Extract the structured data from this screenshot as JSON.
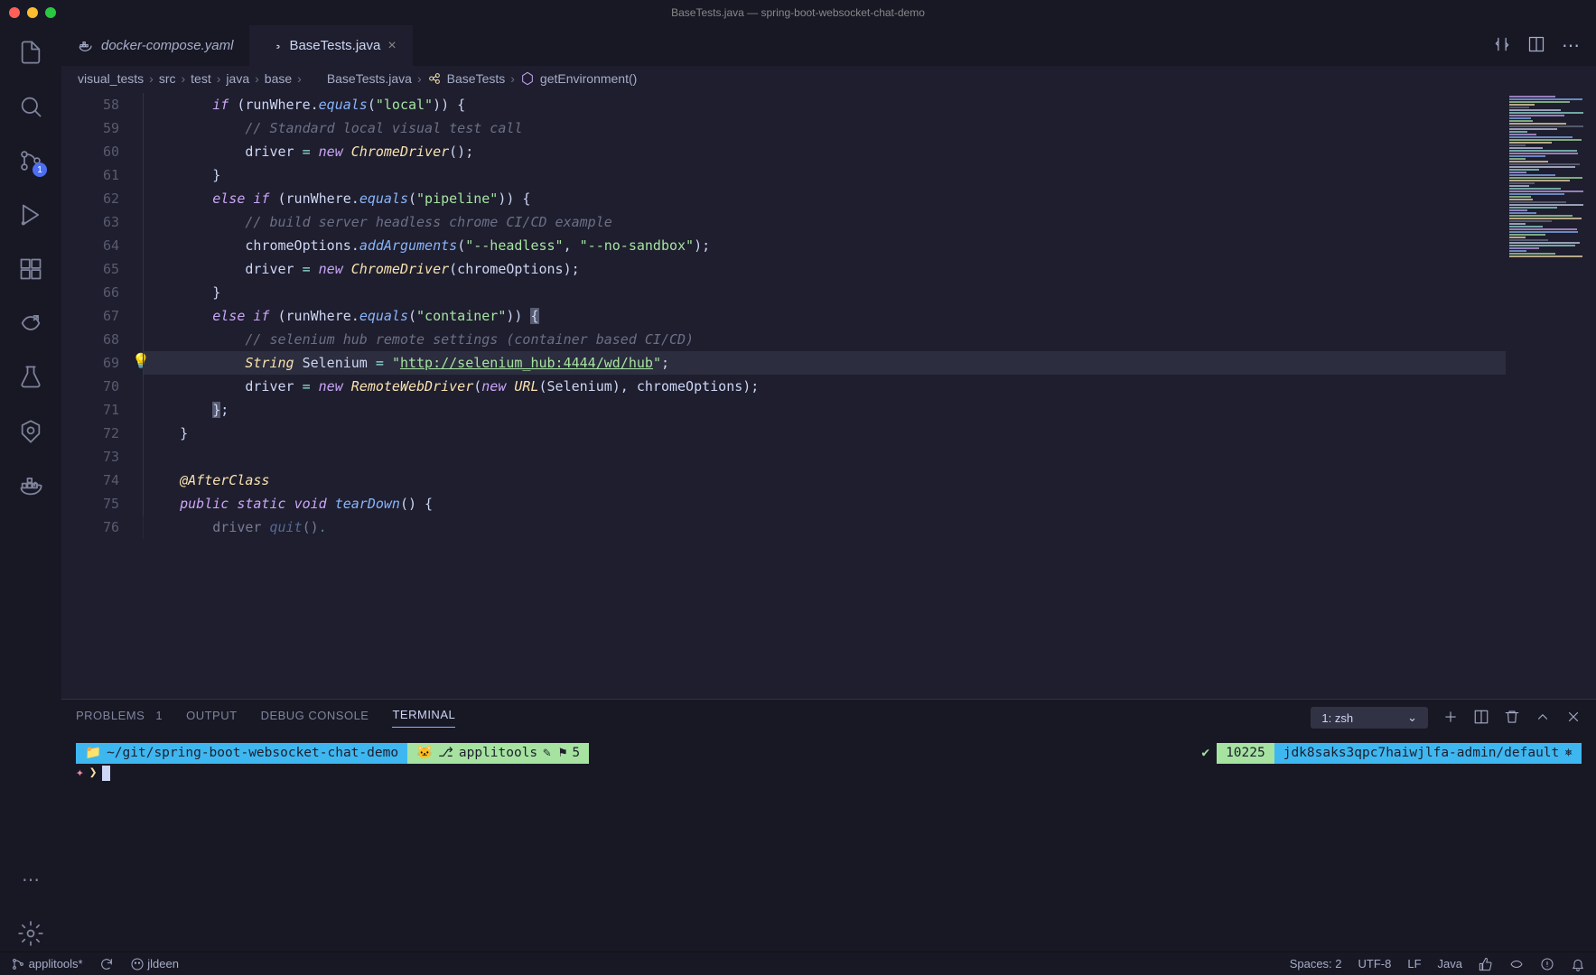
{
  "window": {
    "title": "BaseTests.java — spring-boot-websocket-chat-demo"
  },
  "activity_badge": "1",
  "tabs": [
    {
      "label": "docker-compose.yaml",
      "icon_color": "#2396ed"
    },
    {
      "label": "BaseTests.java",
      "icon_color": "#e06c75"
    }
  ],
  "breadcrumb": {
    "parts": [
      "visual_tests",
      "src",
      "test",
      "java",
      "base",
      "BaseTests.java",
      "BaseTests",
      "getEnvironment()"
    ]
  },
  "line_start": 58,
  "line_count": 19,
  "code_lines": [
    {
      "html": "        <span class='kw'>if</span> (runWhere.<span class='fn'>equals</span>(<span class='str'>\"local\"</span>)) {"
    },
    {
      "html": "            <span class='cmt'>// Standard local visual test call</span>"
    },
    {
      "html": "            driver <span class='op'>=</span> <span class='kw'>new</span> <span class='cls'>ChromeDriver</span>();"
    },
    {
      "html": "        }"
    },
    {
      "html": "        <span class='kw'>else</span> <span class='kw'>if</span> (runWhere.<span class='fn'>equals</span>(<span class='str'>\"pipeline\"</span>)) {"
    },
    {
      "html": "            <span class='cmt'>// build server headless chrome CI/CD example</span>"
    },
    {
      "html": "            chromeOptions.<span class='fn'>addArguments</span>(<span class='str'>\"--headless\"</span>, <span class='str'>\"--no-sandbox\"</span>);"
    },
    {
      "html": "            driver <span class='op'>=</span> <span class='kw'>new</span> <span class='cls'>ChromeDriver</span>(chromeOptions);"
    },
    {
      "html": "        }"
    },
    {
      "html": "        <span class='kw'>else</span> <span class='kw'>if</span> (runWhere.<span class='fn'>equals</span>(<span class='str'>\"container\"</span>)) <span style='background:#585b70'>{</span>"
    },
    {
      "html": "            <span class='cmt'>// selenium hub remote settings (container based CI/CD)</span>"
    },
    {
      "html": "            <span class='cls'>String</span> <span class='var'>Selenium</span> <span class='op'>=</span> <span class='str'>\"</span><span class='url'>http://selenium_hub:4444/wd/hub</span><span class='str'>\"</span>;",
      "hl": true
    },
    {
      "html": "            driver <span class='op'>=</span> <span class='kw'>new</span> <span class='cls'>RemoteWebDriver</span>(<span class='kw'>new</span> <span class='cls'>URL</span>(Selenium), chromeOptions);"
    },
    {
      "html": "        <span style='background:#585b70'>}</span>;"
    },
    {
      "html": "    }"
    },
    {
      "html": ""
    },
    {
      "html": "    <span class='ann'>@AfterClass</span>"
    },
    {
      "html": "    <span class='kw'>public</span> <span class='kw'>static</span> <span class='kw'>void</span> <span class='fn'>tearDown</span>() {"
    },
    {
      "html": "        driver <span class='fn'>quit</span>()<span class='op'>.</span>",
      "dim": true
    }
  ],
  "bulb_at": 69,
  "panel": {
    "tabs": {
      "problems": "PROBLEMS",
      "problems_count": "1",
      "output": "OUTPUT",
      "debug": "DEBUG CONSOLE",
      "terminal": "TERMINAL"
    },
    "terminal_selector": "1: zsh"
  },
  "terminal": {
    "cwd": "~/git/spring-boot-websocket-chat-demo",
    "branch": "applitools",
    "stash": "5",
    "right_num": "10225",
    "right_ctx": "jdk8saks3qpc7haiwjlfa-admin/default"
  },
  "status": {
    "branch": "applitools*",
    "user": "jldeen",
    "spaces": "Spaces: 2",
    "encoding": "UTF-8",
    "eol": "LF",
    "lang": "Java"
  }
}
